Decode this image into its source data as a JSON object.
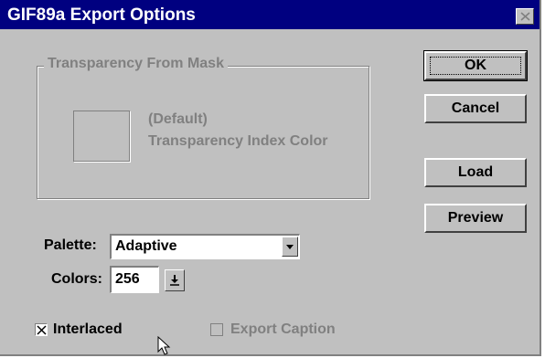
{
  "window": {
    "title": "GIF89a Export Options"
  },
  "transparency": {
    "group_label": "Transparency From Mask",
    "default_label": "(Default)",
    "index_label": "Transparency Index Color",
    "swatch_color": "#c0c0c0"
  },
  "buttons": {
    "ok": "OK",
    "cancel": "Cancel",
    "load": "Load",
    "preview": "Preview"
  },
  "palette": {
    "label": "Palette:",
    "value": "Adaptive"
  },
  "colors": {
    "label": "Colors:",
    "value": "256"
  },
  "options": {
    "interlaced": {
      "label": "Interlaced",
      "checked": true,
      "enabled": true
    },
    "export_caption": {
      "label": "Export Caption",
      "checked": false,
      "enabled": false
    }
  },
  "icons": {
    "close": "close-icon",
    "dropdown": "chevron-down-icon",
    "spin": "spin-down-icon",
    "check": "checkmark-icon",
    "cursor": "mouse-pointer-icon"
  },
  "theme": {
    "titlebar_bg": "#000080",
    "face": "#c0c0c0",
    "disabled_text": "#808080"
  }
}
